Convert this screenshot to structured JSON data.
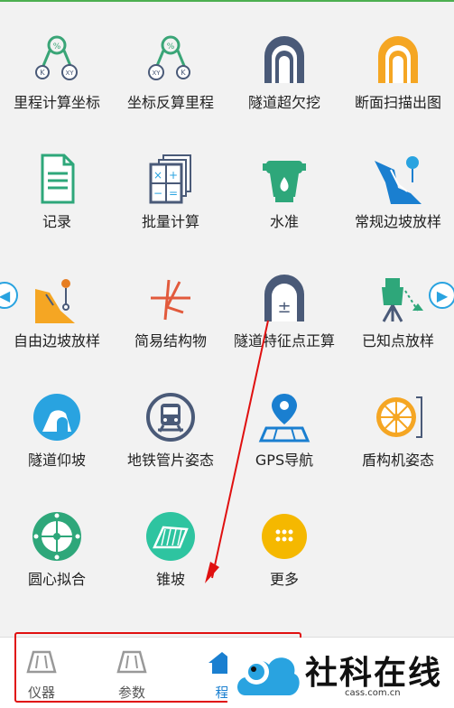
{
  "grid": {
    "items": [
      {
        "label": "里程计算坐标",
        "icon": "km-xy-calc-icon"
      },
      {
        "label": "坐标反算里程",
        "icon": "xy-km-calc-icon"
      },
      {
        "label": "隧道超欠挖",
        "icon": "tunnel-overbreak-icon"
      },
      {
        "label": "断面扫描出图",
        "icon": "section-scan-icon"
      },
      {
        "label": "记录",
        "icon": "record-document-icon"
      },
      {
        "label": "批量计算",
        "icon": "batch-calc-icon"
      },
      {
        "label": "水准",
        "icon": "level-instrument-icon"
      },
      {
        "label": "常规边坡放样",
        "icon": "slope-layout-icon"
      },
      {
        "label": "自由边坡放样",
        "icon": "free-slope-icon"
      },
      {
        "label": "简易结构物",
        "icon": "simple-structure-icon"
      },
      {
        "label": "隧道特征点正算",
        "icon": "tunnel-feature-point-icon"
      },
      {
        "label": "已知点放样",
        "icon": "known-point-layout-icon"
      },
      {
        "label": "隧道仰坡",
        "icon": "tunnel-slope-icon"
      },
      {
        "label": "地铁管片姿态",
        "icon": "metro-segment-icon"
      },
      {
        "label": "GPS导航",
        "icon": "gps-navigation-icon"
      },
      {
        "label": "盾构机姿态",
        "icon": "shield-machine-icon"
      },
      {
        "label": "圆心拟合",
        "icon": "circle-fit-icon"
      },
      {
        "label": "锥坡",
        "icon": "cone-slope-icon"
      },
      {
        "label": "更多",
        "icon": "more-icon"
      }
    ]
  },
  "bottom_nav": {
    "tabs": [
      {
        "label": "仪器"
      },
      {
        "label": "参数"
      },
      {
        "label": "程"
      }
    ]
  },
  "watermark": {
    "text": "社科在线",
    "url": "cass.com.cn"
  },
  "colors": {
    "accent_blue": "#29a3e0",
    "green": "#3cb371",
    "orange": "#f5a623",
    "dark_slate": "#4a5a78",
    "annotation_red": "#e01010"
  }
}
